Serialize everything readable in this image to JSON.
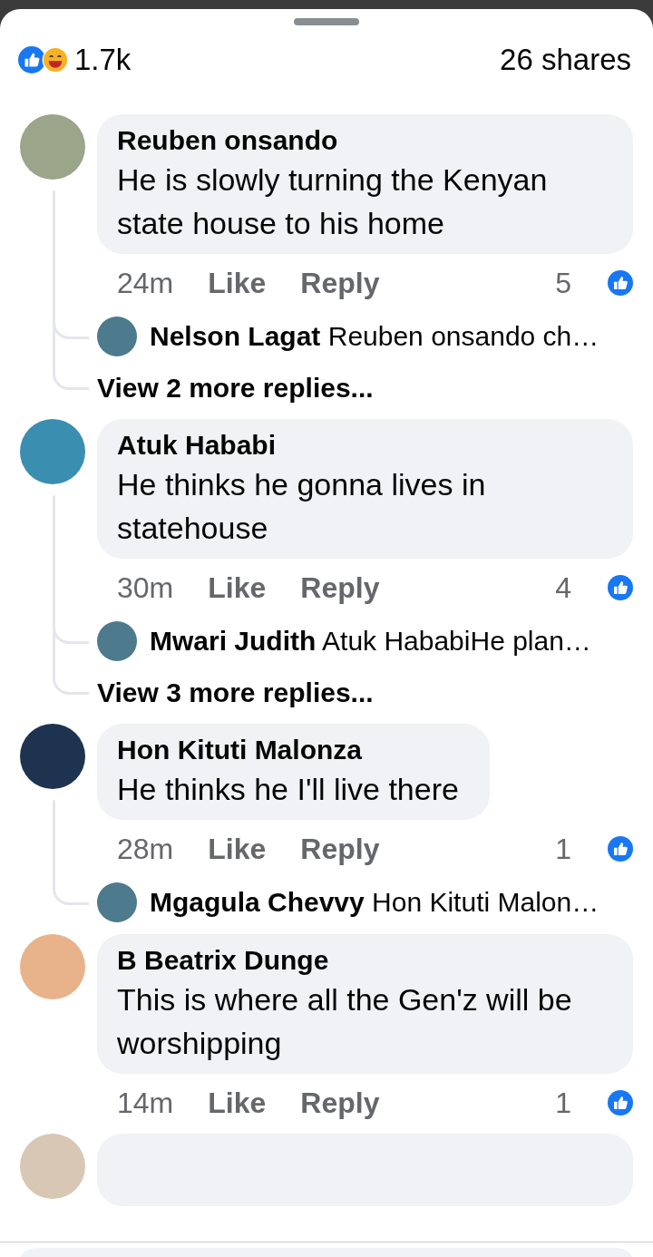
{
  "header": {
    "reactions_count": "1.7k",
    "shares": "26 shares"
  },
  "comments": [
    {
      "author": "Reuben onsando",
      "text": "He is slowly turning the Kenyan state house to his home",
      "time": "24m",
      "like_label": "Like",
      "reply_label": "Reply",
      "likes": "5",
      "replies": [
        {
          "author": "Nelson Lagat",
          "text": "Reuben onsando ch…"
        }
      ],
      "more_replies": "View 2 more replies..."
    },
    {
      "author": "Atuk Hababi",
      "text": "He thinks he gonna lives in statehouse",
      "time": "30m",
      "like_label": "Like",
      "reply_label": "Reply",
      "likes": "4",
      "replies": [
        {
          "author": "Mwari Judith",
          "text": "Atuk HababiHe plan…"
        }
      ],
      "more_replies": "View 3 more replies..."
    },
    {
      "author": "Hon Kituti Malonza",
      "text": "He thinks he I'll live there",
      "time": "28m",
      "like_label": "Like",
      "reply_label": "Reply",
      "likes": "1",
      "replies": [
        {
          "author": "Mgagula Chevvy",
          "text": "Hon Kituti Malon…"
        }
      ]
    },
    {
      "author": "B Beatrix Dunge",
      "text": "This is where all the Gen'z will be worshipping",
      "time": "14m",
      "like_label": "Like",
      "reply_label": "Reply",
      "likes": "1"
    }
  ]
}
